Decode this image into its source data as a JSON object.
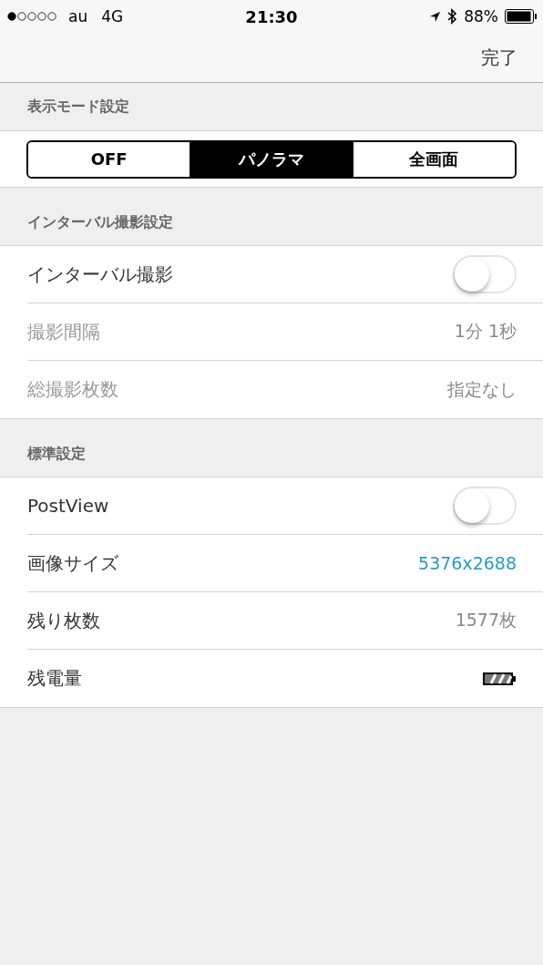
{
  "status_bar": {
    "carrier": "au",
    "network": "4G",
    "time": "21:30",
    "battery": "88%"
  },
  "nav_bar": {
    "done_button": "完了"
  },
  "sections": [
    {
      "header": "表示モード設定",
      "kind": "segmented",
      "segments": [
        {
          "label": "OFF",
          "selected": false
        },
        {
          "label": "パノラマ",
          "selected": true
        },
        {
          "label": "全画面",
          "selected": false
        }
      ]
    },
    {
      "header": "インターバル撮影設定",
      "kind": "rows",
      "rows": [
        {
          "kind": "toggle",
          "label": "インターバル撮影",
          "disabled": false,
          "on": false
        },
        {
          "kind": "value",
          "label": "撮影間隔",
          "disabled": true,
          "value": "1分 1秒"
        },
        {
          "kind": "value",
          "label": "総撮影枚数",
          "disabled": true,
          "value": "指定なし"
        }
      ]
    },
    {
      "header": "標準設定",
      "kind": "rows",
      "rows": [
        {
          "kind": "toggle",
          "label": "PostView",
          "disabled": false,
          "on": false
        },
        {
          "kind": "link",
          "label": "画像サイズ",
          "disabled": false,
          "value": "5376x2688"
        },
        {
          "kind": "value",
          "label": "残り枚数",
          "disabled": false,
          "value": "1577枚"
        },
        {
          "kind": "battery",
          "label": "残電量",
          "disabled": false
        }
      ]
    }
  ]
}
